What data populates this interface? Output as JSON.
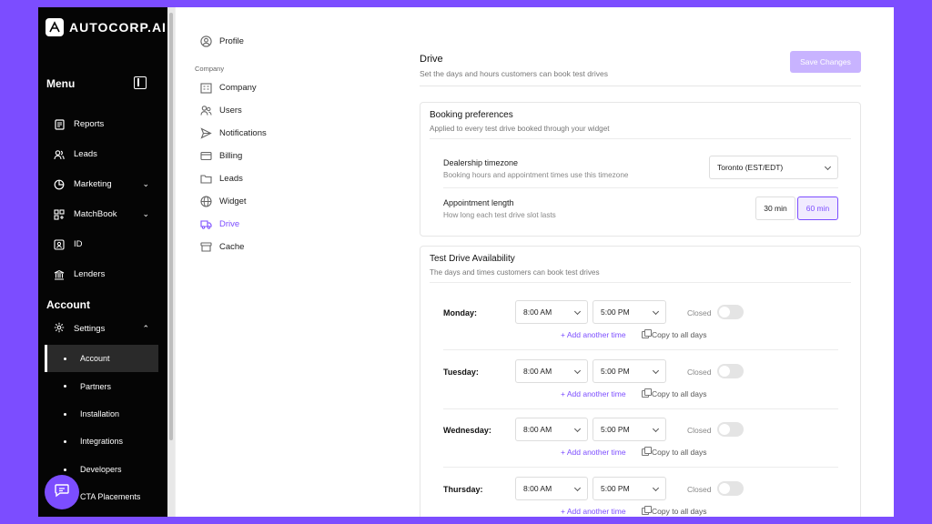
{
  "brand": {
    "name": "AUTOCORP.AI"
  },
  "sidebar": {
    "menu_title": "Menu",
    "items": [
      {
        "label": "Reports",
        "icon": "reports-icon"
      },
      {
        "label": "Leads",
        "icon": "users-icon"
      },
      {
        "label": "Marketing",
        "icon": "chart-icon",
        "expandable": true
      },
      {
        "label": "MatchBook",
        "icon": "grid-icon",
        "expandable": true
      },
      {
        "label": "ID",
        "icon": "id-card-icon"
      },
      {
        "label": "Lenders",
        "icon": "bank-icon"
      }
    ],
    "account_title": "Account",
    "settings_label": "Settings",
    "sub_items": [
      "Account",
      "Partners",
      "Installation",
      "Integrations",
      "Developers",
      "CTA Placements"
    ],
    "active_sub": "Account"
  },
  "settings_nav": {
    "profile": "Profile",
    "group_label": "Company",
    "items": [
      "Company",
      "Users",
      "Notifications",
      "Billing",
      "Leads",
      "Widget",
      "Drive",
      "Cache"
    ],
    "active": "Drive"
  },
  "main": {
    "title": "Drive",
    "subtitle": "Set the days and hours customers can book test drives",
    "save_label": "Save Changes",
    "booking": {
      "title": "Booking preferences",
      "subtitle": "Applied to every test drive booked through your widget",
      "timezone_label": "Dealership timezone",
      "timezone_sub": "Booking hours and appointment times use this timezone",
      "timezone_value": "Toronto (EST/EDT)",
      "length_label": "Appointment length",
      "length_sub": "How long each test drive slot lasts",
      "length_options": [
        "30 min",
        "60 min"
      ],
      "length_selected": "60 min"
    },
    "availability": {
      "title": "Test Drive Availability",
      "subtitle": "The days and times customers can book test drives",
      "closed_label": "Closed",
      "add_label": "+ Add another time",
      "copy_label": "Copy to all days",
      "days": [
        {
          "day": "Monday:",
          "start": "8:00 AM",
          "end": "5:00 PM"
        },
        {
          "day": "Tuesday:",
          "start": "8:00 AM",
          "end": "5:00 PM"
        },
        {
          "day": "Wednesday:",
          "start": "8:00 AM",
          "end": "5:00 PM"
        },
        {
          "day": "Thursday:",
          "start": "8:00 AM",
          "end": "5:00 PM"
        }
      ]
    }
  },
  "colors": {
    "accent": "#7c4dff",
    "sidebar_bg": "#050505"
  }
}
